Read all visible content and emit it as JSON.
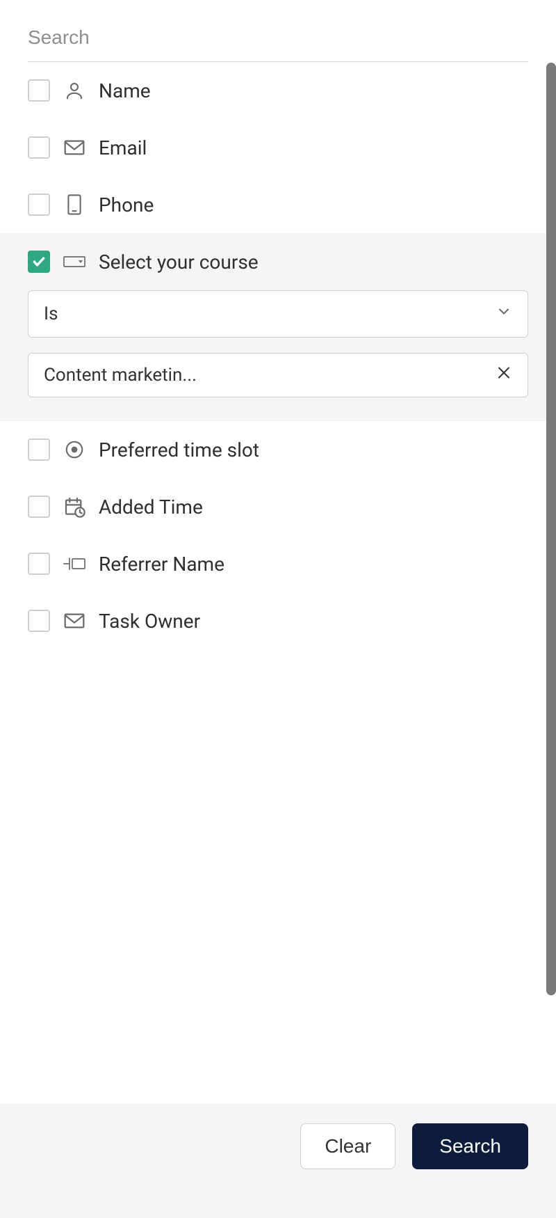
{
  "search": {
    "placeholder": "Search"
  },
  "filters": {
    "name": {
      "label": "Name"
    },
    "email": {
      "label": "Email"
    },
    "phone": {
      "label": "Phone"
    },
    "course": {
      "label": "Select your course",
      "operator": "Is",
      "value": "Content marketin..."
    },
    "timeslot": {
      "label": "Preferred time slot"
    },
    "addedtime": {
      "label": "Added Time"
    },
    "referrer": {
      "label": "Referrer Name"
    },
    "owner": {
      "label": "Task Owner"
    }
  },
  "footer": {
    "clear": "Clear",
    "search": "Search"
  }
}
